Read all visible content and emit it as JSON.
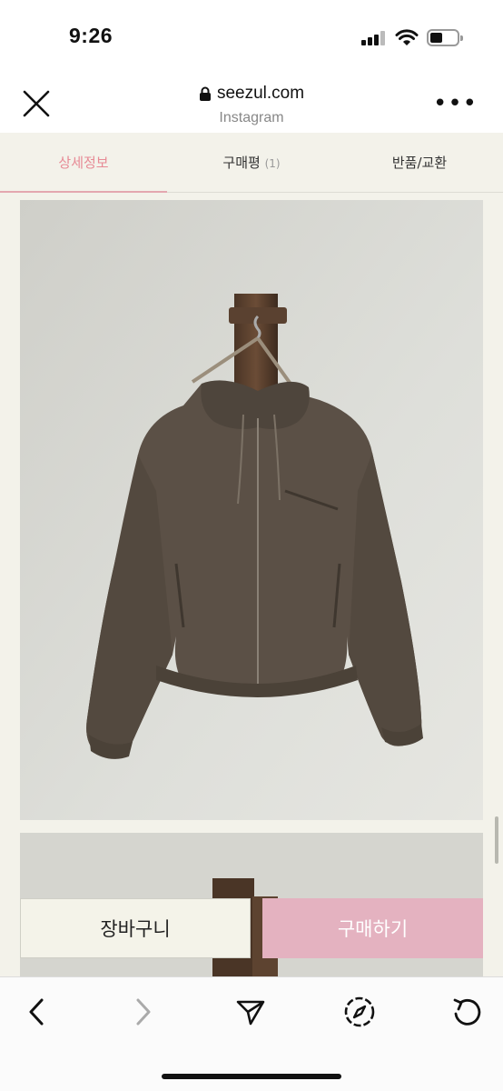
{
  "status_bar": {
    "time": "9:26"
  },
  "browser": {
    "domain": "seezul.com",
    "source": "Instagram",
    "icons": {
      "close": "close-icon",
      "lock": "lock-icon",
      "more": "more-icon"
    }
  },
  "tabs": [
    {
      "label": "상세정보",
      "active": true
    },
    {
      "label": "구매평",
      "count": "(1)"
    },
    {
      "label": "반품/교환"
    }
  ],
  "product_images": [
    {
      "subject": "brown hooded zip-up jacket on wooden wall hanger"
    },
    {
      "subject": "wooden wall hanger"
    }
  ],
  "actions": {
    "cart_label": "장바구니",
    "buy_label": "구매하기"
  },
  "toolbar": {
    "icons": [
      "back-icon",
      "forward-icon",
      "share-icon",
      "compass-icon",
      "reload-icon"
    ]
  },
  "colors": {
    "accent_pink": "#e4b2c0",
    "active_tab": "#e78a95",
    "page_bg": "#f3f2ea"
  }
}
